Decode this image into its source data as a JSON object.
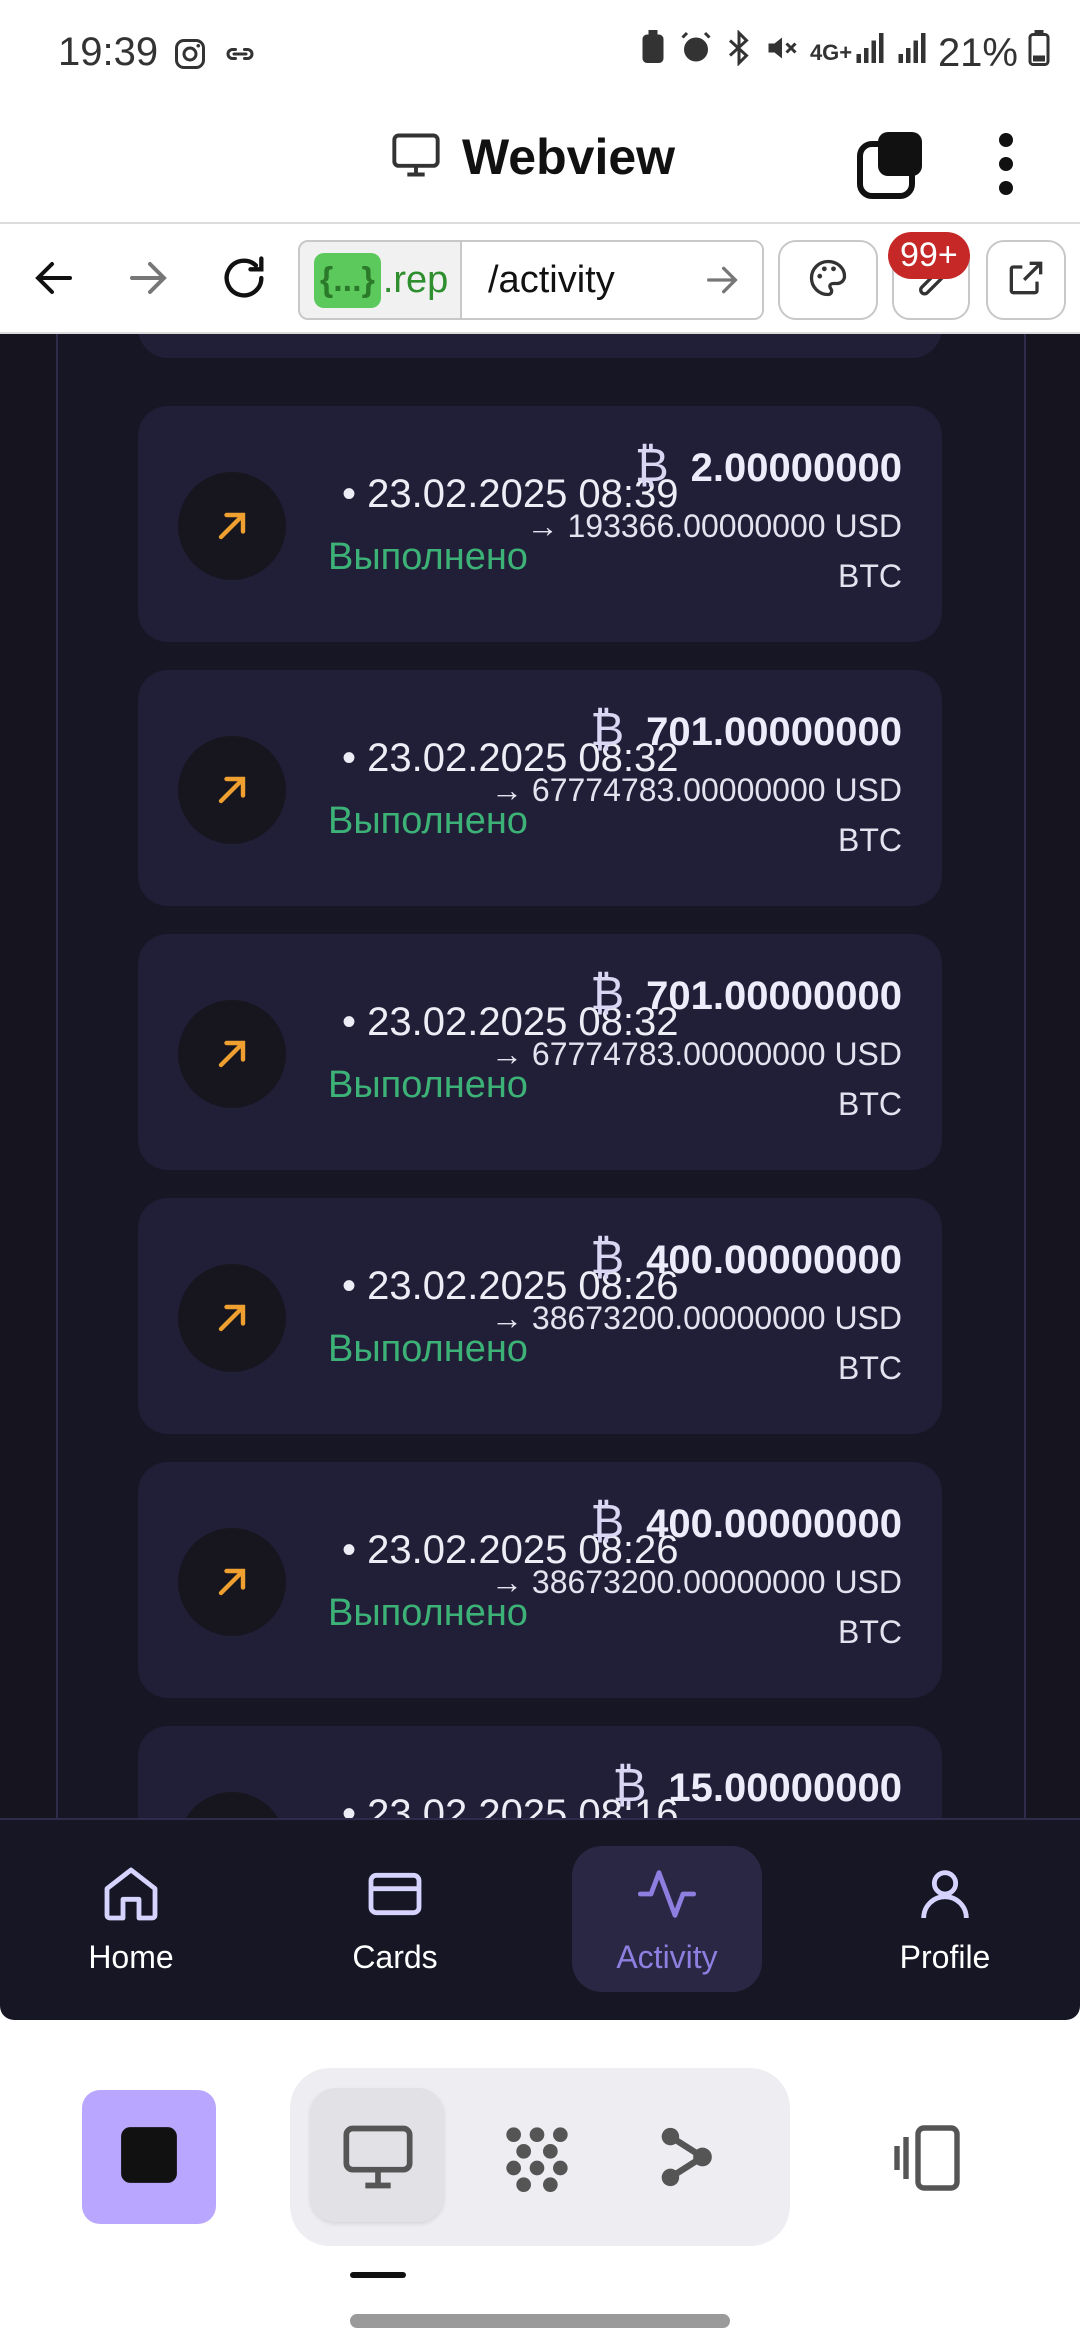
{
  "status_bar": {
    "time": "19:39",
    "network": "4G+",
    "battery": "21%",
    "icons": [
      "instagram-icon",
      "link-icon",
      "battery-saver-icon",
      "alarm-icon",
      "bluetooth-icon",
      "mute-icon",
      "signal-icon",
      "signal-icon",
      "battery-icon"
    ]
  },
  "app_bar": {
    "title": "Webview",
    "icons": [
      "monitor-icon",
      "tabs-icon",
      "more-vert-icon"
    ]
  },
  "toolbar": {
    "url_chip": "{...}",
    "url_host": ".rep",
    "url_path": "/activity",
    "badge": "99+",
    "icons": [
      "back-icon",
      "forward-icon",
      "reload-icon",
      "go-icon",
      "palette-icon",
      "wrench-icon",
      "open-external-icon"
    ]
  },
  "transactions": [
    {
      "date": "• 23.02.2025 08:39",
      "status": "Выполнено",
      "amount": "2.00000000",
      "conversion": "→ 193366.00000000 USD",
      "currency": "BTC",
      "btc_symbol": "₿"
    },
    {
      "date": "• 23.02.2025 08:32",
      "status": "Выполнено",
      "amount": "701.00000000",
      "conversion": "→ 67774783.00000000 USD",
      "currency": "BTC",
      "btc_symbol": "₿"
    },
    {
      "date": "• 23.02.2025 08:32",
      "status": "Выполнено",
      "amount": "701.00000000",
      "conversion": "→ 67774783.00000000 USD",
      "currency": "BTC",
      "btc_symbol": "₿"
    },
    {
      "date": "• 23.02.2025 08:26",
      "status": "Выполнено",
      "amount": "400.00000000",
      "conversion": "→ 38673200.00000000 USD",
      "currency": "BTC",
      "btc_symbol": "₿"
    },
    {
      "date": "• 23.02.2025 08:26",
      "status": "Выполнено",
      "amount": "400.00000000",
      "conversion": "→ 38673200.00000000 USD",
      "currency": "BTC",
      "btc_symbol": "₿"
    },
    {
      "date": "• 23.02.2025 08:16",
      "status": "",
      "amount": "15.00000000",
      "conversion": "",
      "currency": "",
      "btc_symbol": "₿"
    }
  ],
  "bottom_nav": [
    {
      "label": "Home",
      "icon": "home-icon"
    },
    {
      "label": "Cards",
      "icon": "card-icon"
    },
    {
      "label": "Activity",
      "icon": "activity-icon",
      "active": true
    },
    {
      "label": "Profile",
      "icon": "profile-icon"
    }
  ],
  "bottom_tools": {
    "icons": [
      "stop-icon",
      "monitor-icon",
      "graph-icon",
      "share-node-icon",
      "split-view-icon"
    ]
  },
  "colors": {
    "accent": "#8e7ee0",
    "status_done": "#3cb277",
    "arrow_orange": "#f0a030",
    "card_bg": "#211e38",
    "page_bg": "#171624"
  }
}
